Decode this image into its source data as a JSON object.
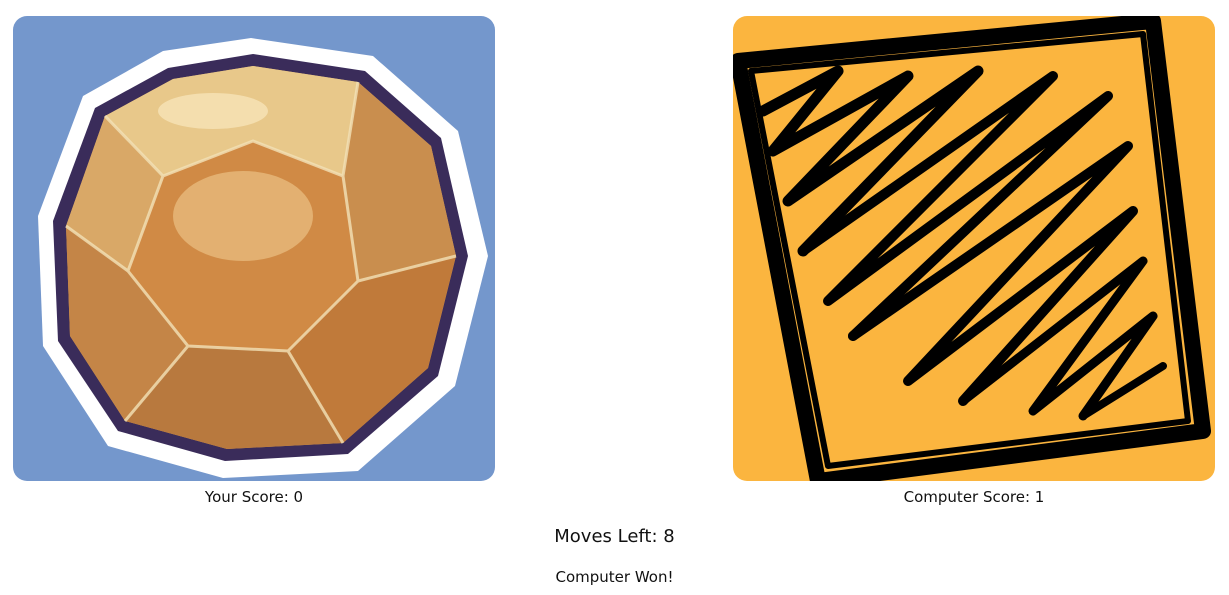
{
  "player": {
    "score_label": "Your Score: 0",
    "choice_icon": "rock-icon",
    "card_color": "#7497cc"
  },
  "computer": {
    "score_label": "Computer Score: 1",
    "choice_icon": "paper-icon",
    "card_color": "#fbb53f"
  },
  "status": {
    "moves_left": "Moves Left: 8",
    "result": "Computer Won!"
  }
}
